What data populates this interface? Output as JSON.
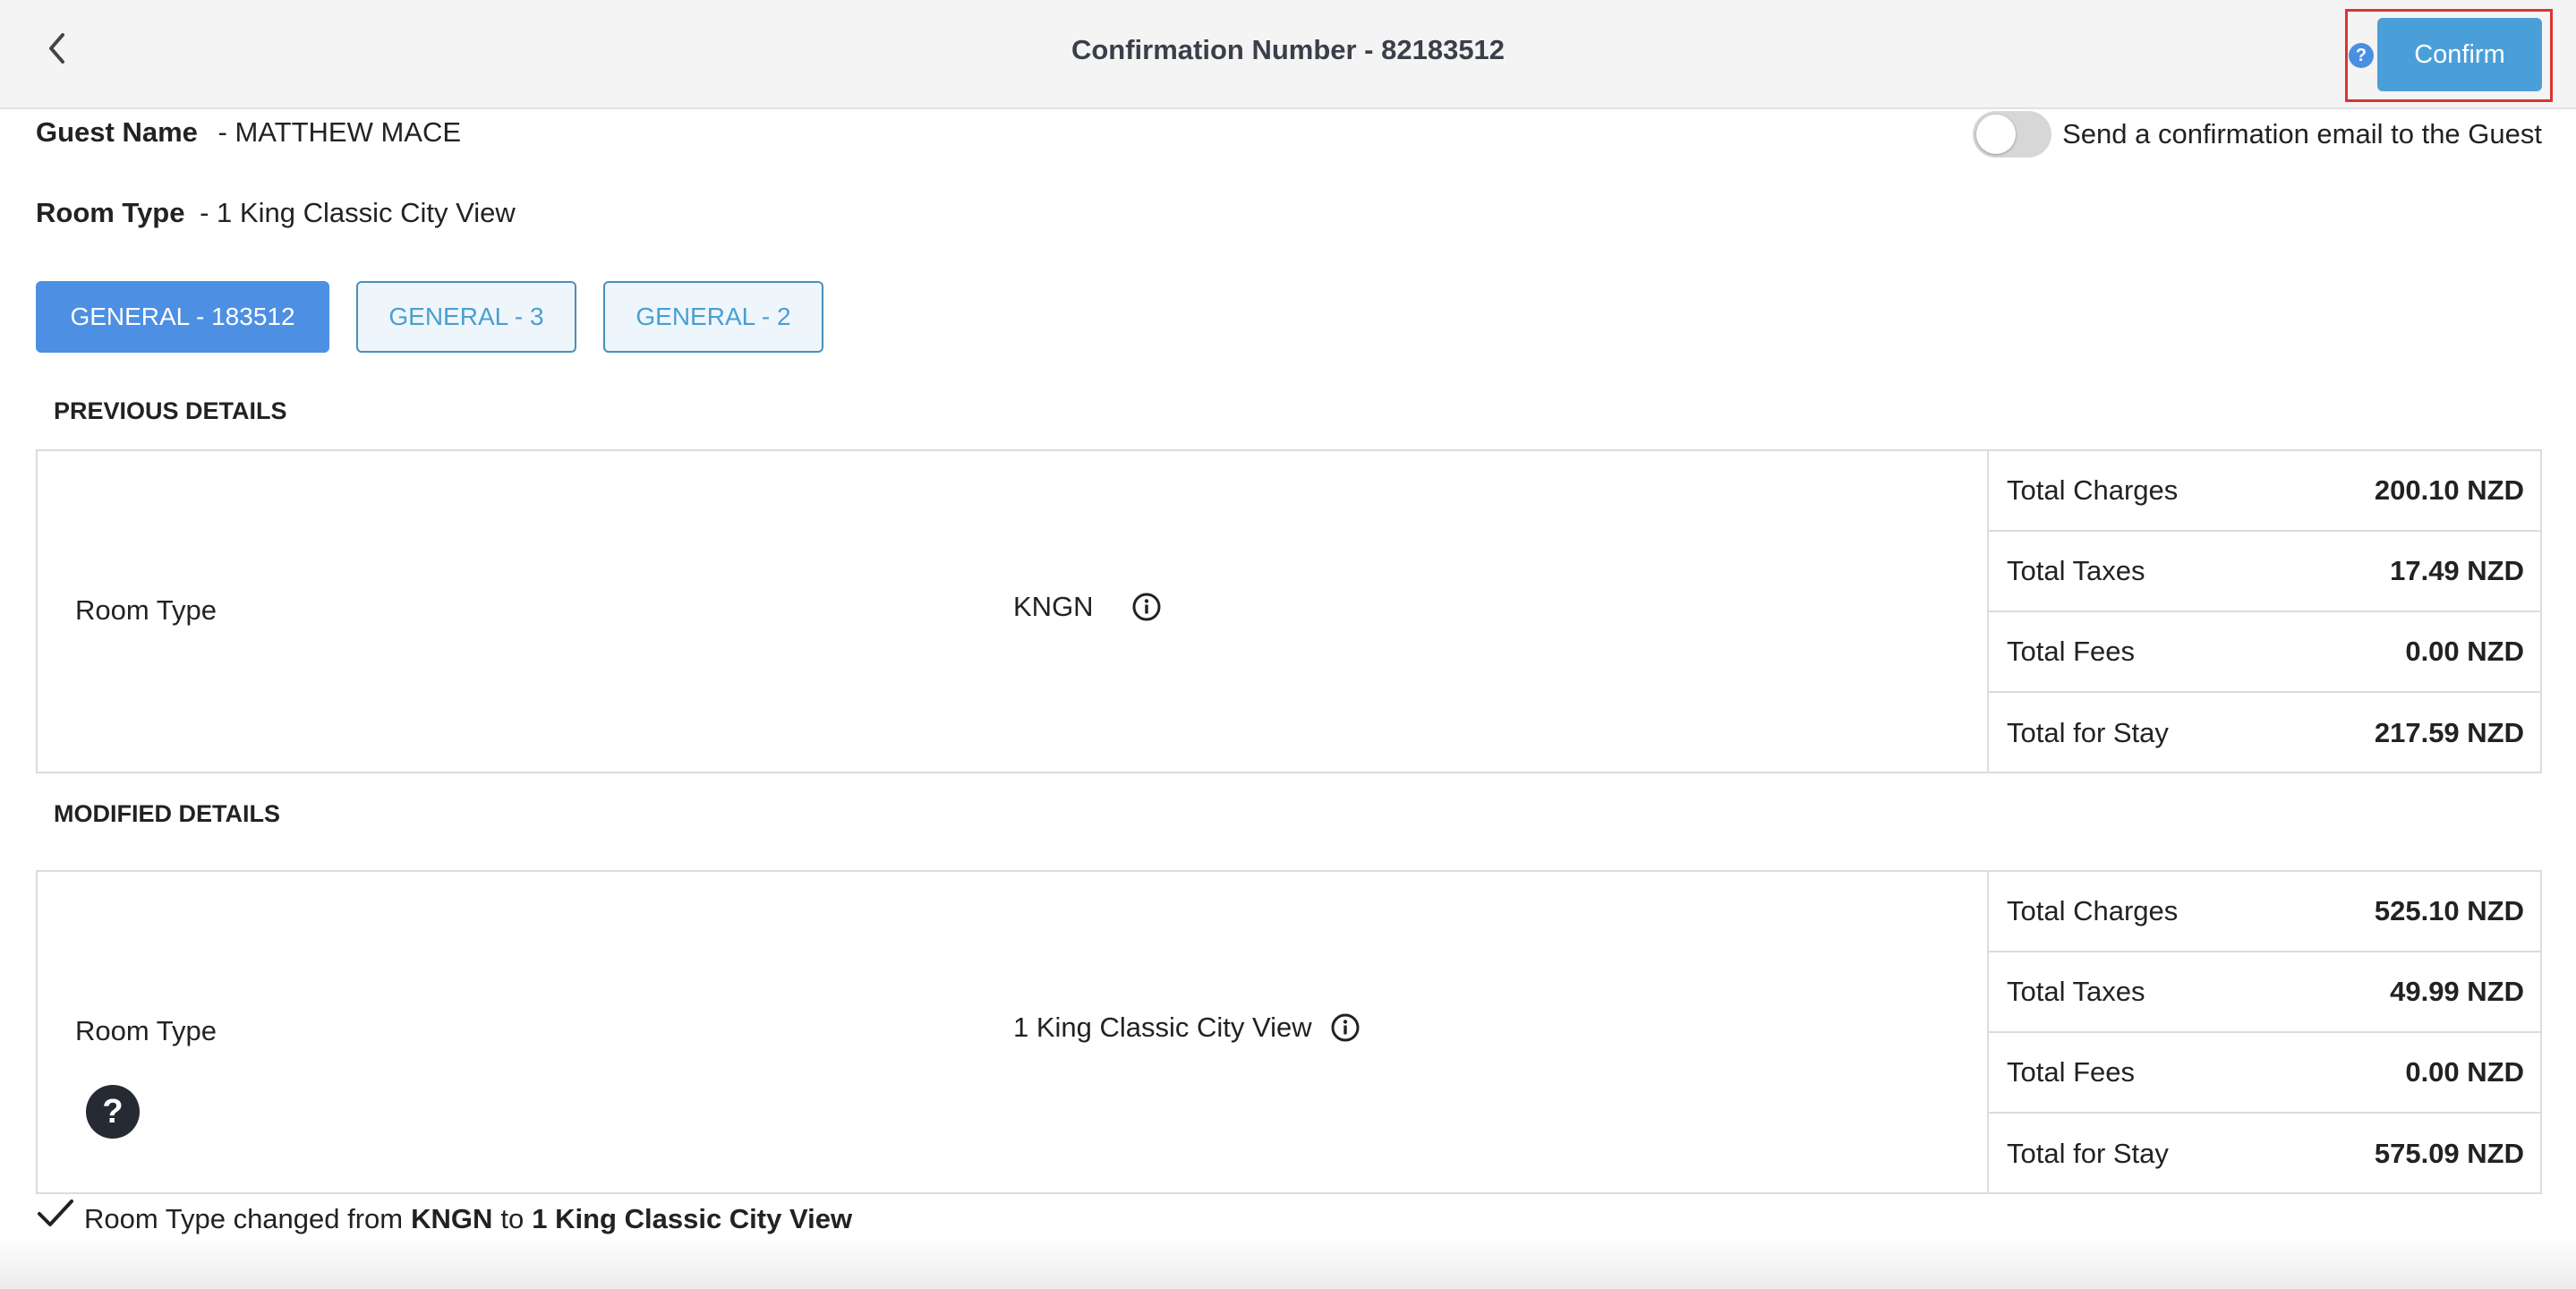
{
  "header": {
    "title": "Confirmation Number - 82183512",
    "confirm_label": "Confirm",
    "help_glyph": "?",
    "back_icon": "chevron-left-icon"
  },
  "guest": {
    "name_label": "Guest Name",
    "name_value": "- MATTHEW MACE",
    "room_label": "Room Type",
    "room_value": "- 1 King Classic City View"
  },
  "email_toggle": {
    "label": "Send a confirmation email to the Guest",
    "on": false
  },
  "tabs": [
    {
      "label": "GENERAL - 183512",
      "active": true
    },
    {
      "label": "GENERAL - 3",
      "active": false
    },
    {
      "label": "GENERAL - 2",
      "active": false
    }
  ],
  "previous": {
    "section_title": "PREVIOUS DETAILS",
    "room_label": "Room Type",
    "room_value": "KNGN",
    "totals": [
      {
        "label": "Total Charges",
        "amount": "200.10 NZD"
      },
      {
        "label": "Total Taxes",
        "amount": "17.49 NZD"
      },
      {
        "label": "Total Fees",
        "amount": "0.00 NZD"
      },
      {
        "label": "Total for Stay",
        "amount": "217.59 NZD"
      }
    ]
  },
  "modified": {
    "section_title": "MODIFIED DETAILS",
    "room_label": "Room Type",
    "room_value": "1 King Classic City View",
    "help_glyph": "?",
    "totals": [
      {
        "label": "Total Charges",
        "amount": "525.10 NZD"
      },
      {
        "label": "Total Taxes",
        "amount": "49.99 NZD"
      },
      {
        "label": "Total Fees",
        "amount": "0.00 NZD"
      },
      {
        "label": "Total for Stay",
        "amount": "575.09 NZD"
      }
    ]
  },
  "change_note": {
    "prefix": "Room Type changed from",
    "from": "KNGN",
    "middle": "to",
    "to": "1 King Classic City View"
  },
  "colors": {
    "confirm_button": "#4a9fd9",
    "active_tab": "#4d8fe3",
    "highlight_border": "#d9352f"
  }
}
